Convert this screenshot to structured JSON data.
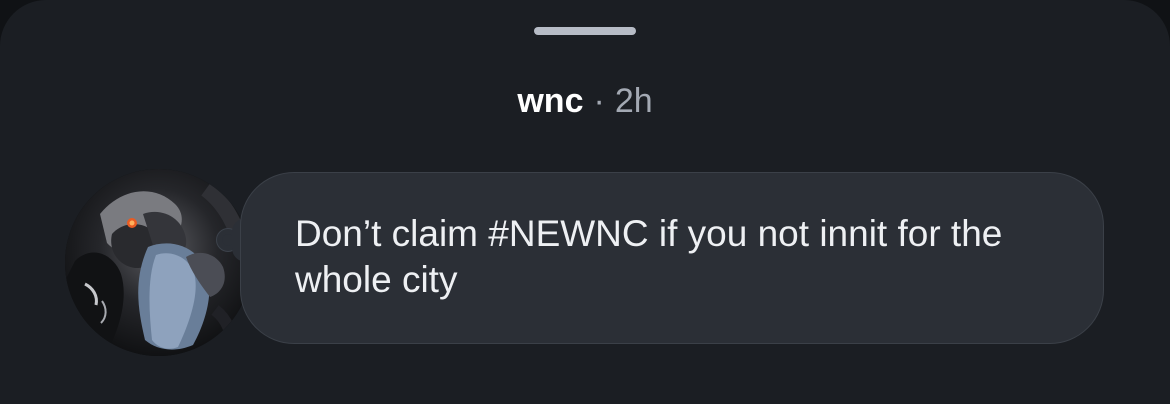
{
  "post": {
    "username": "wnc",
    "separator": "·",
    "time": "2h",
    "message": "Don’t claim #NEWNC if you not innit for the whole city"
  },
  "colors": {
    "background": "#1b1e23",
    "bubble": "#2b2f36",
    "text": "#eef0f3",
    "muted": "#a3a9b3"
  },
  "icons": {
    "grabber": "drag-handle-icon"
  }
}
